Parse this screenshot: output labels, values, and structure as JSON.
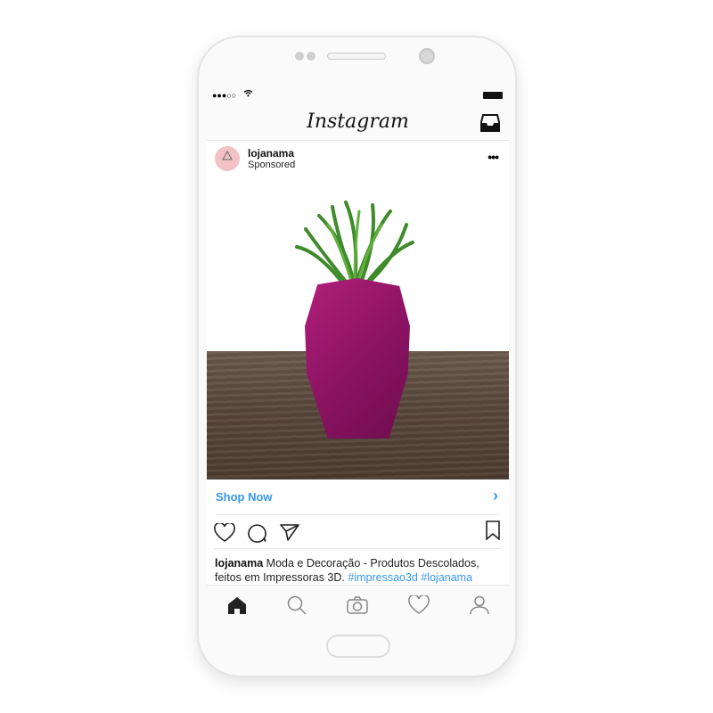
{
  "status_bar": {
    "signal": "●●●○○",
    "wifi_icon": "wifi-icon",
    "battery_icon": "battery-icon"
  },
  "header": {
    "title": "Instagram",
    "inbox_icon": "inbox-icon"
  },
  "post": {
    "username": "lojanama",
    "subtitle": "Sponsored",
    "avatar_text": "lojanama",
    "more_label": "•••",
    "cta_label": "Shop Now",
    "cta_arrow": "›",
    "caption_user": "lojanama",
    "caption_text": " Moda e Decoração - Produtos Descolados, feitos em Impressoras 3D. ",
    "hashtags": [
      "#impressao3d",
      "#lojanama"
    ]
  },
  "actions": [
    "heart-icon",
    "comment-icon",
    "share-icon",
    "bookmark-icon"
  ],
  "tabbar": [
    "home-icon",
    "search-icon",
    "camera-icon",
    "activity-heart-icon",
    "profile-icon"
  ],
  "colors": {
    "link": "#3897f0",
    "skull": "#a0186e"
  }
}
